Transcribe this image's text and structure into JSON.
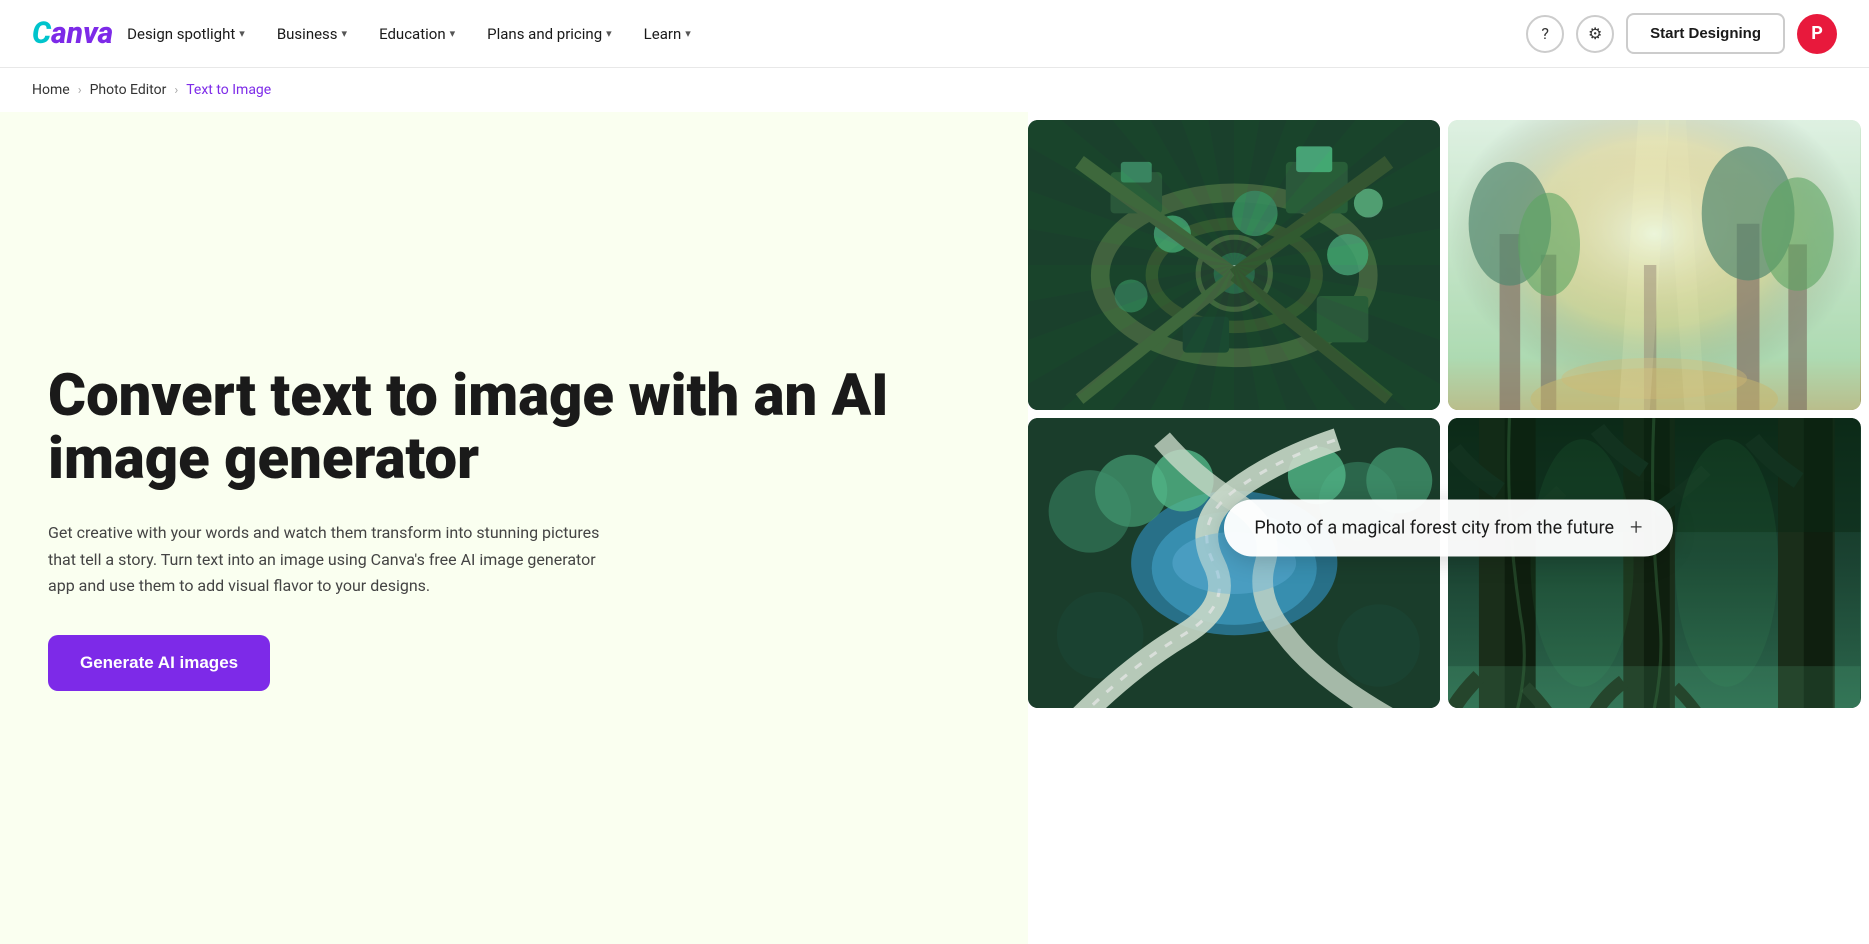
{
  "nav": {
    "logo": "Canva",
    "links": [
      {
        "id": "design-spotlight",
        "label": "Design spotlight",
        "hasDropdown": true
      },
      {
        "id": "business",
        "label": "Business",
        "hasDropdown": true
      },
      {
        "id": "education",
        "label": "Education",
        "hasDropdown": true
      },
      {
        "id": "plans-pricing",
        "label": "Plans and pricing",
        "hasDropdown": true
      },
      {
        "id": "learn",
        "label": "Learn",
        "hasDropdown": true
      }
    ],
    "startBtn": "Start Designing",
    "avatarInitial": "P"
  },
  "breadcrumb": {
    "home": "Home",
    "photoEditor": "Photo Editor",
    "current": "Text to Image"
  },
  "hero": {
    "title": "Convert text to image with an AI image generator",
    "description": "Get creative with your words and watch them transform into stunning pictures that tell a story. Turn text into an image using Canva's free AI image generator app and use them to add visual flavor to your designs.",
    "ctaLabel": "Generate AI images"
  },
  "prompt": {
    "text": "Photo of a magical forest city from the future",
    "plusSymbol": "+"
  }
}
